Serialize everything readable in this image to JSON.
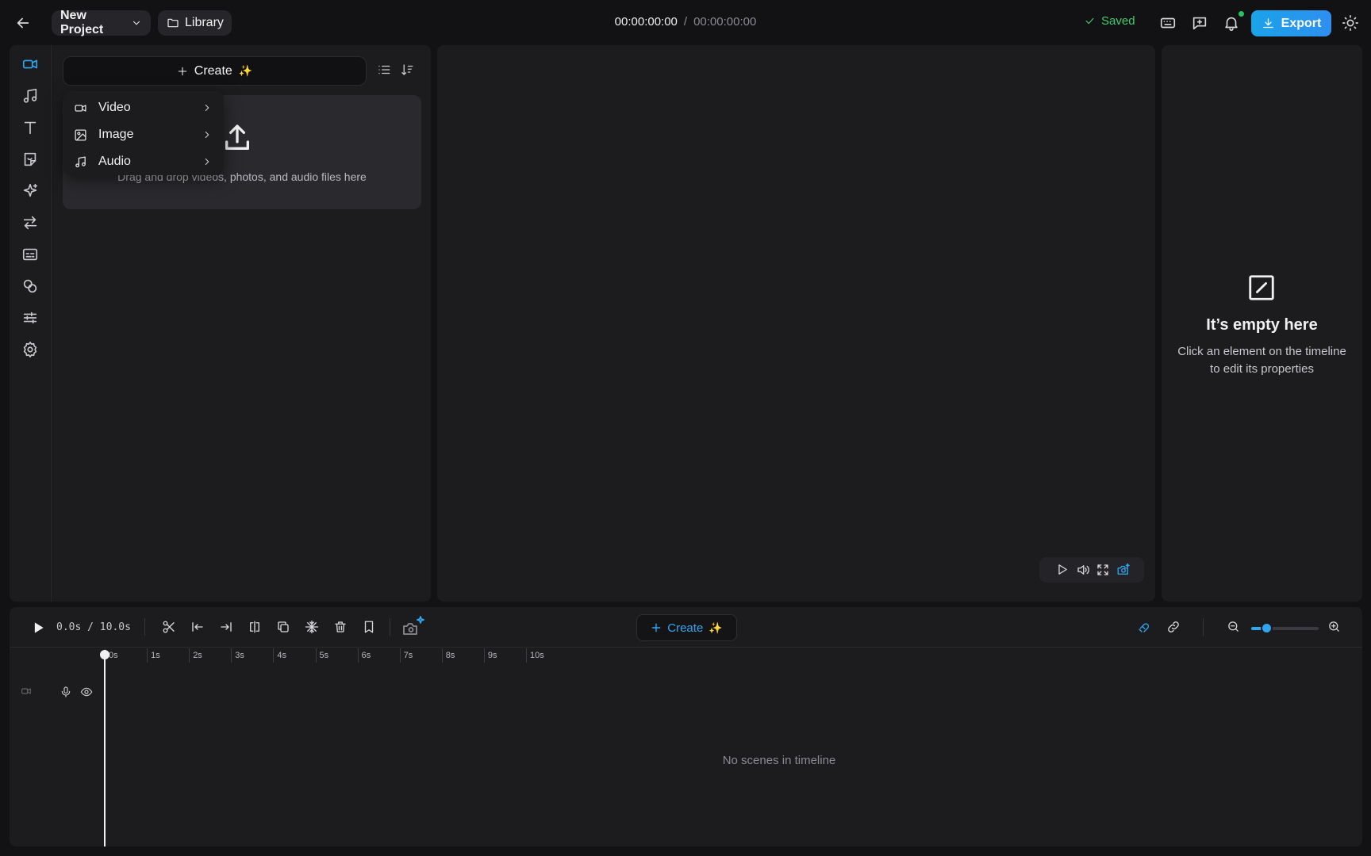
{
  "topbar": {
    "project_name": "New Project",
    "library_label": "Library",
    "timecode_current": "00:00:00:00",
    "timecode_separator": "/",
    "timecode_total": "00:00:00:00",
    "saved_label": "Saved",
    "export_label": "Export"
  },
  "sidebar": {
    "items": [
      {
        "name": "video",
        "icon": "video-camera-icon",
        "active": true
      },
      {
        "name": "audio",
        "icon": "music-note-icon"
      },
      {
        "name": "text",
        "icon": "text-icon"
      },
      {
        "name": "stickers",
        "icon": "sticker-icon"
      },
      {
        "name": "effects",
        "icon": "sparkles-icon"
      },
      {
        "name": "transitions",
        "icon": "transition-arrows-icon"
      },
      {
        "name": "captions",
        "icon": "captions-icon"
      },
      {
        "name": "filters",
        "icon": "filter-circles-icon"
      },
      {
        "name": "adjust",
        "icon": "sliders-icon"
      },
      {
        "name": "settings",
        "icon": "gear-icon"
      }
    ]
  },
  "media_panel": {
    "create_label": "Create",
    "dropzone_text": "Drag and drop videos, photos, and audio files here"
  },
  "create_menu": {
    "items": [
      {
        "label": "Video",
        "icon": "video-camera-icon"
      },
      {
        "label": "Image",
        "icon": "image-icon"
      },
      {
        "label": "Audio",
        "icon": "music-note-icon"
      }
    ]
  },
  "properties": {
    "empty_title": "It’s empty here",
    "empty_subtitle": "Click an element on the timeline to edit its properties"
  },
  "timeline": {
    "time_display": "0.0s / 10.0s",
    "create_label": "Create",
    "ruler_ticks": [
      "0s",
      "1s",
      "2s",
      "3s",
      "4s",
      "5s",
      "6s",
      "7s",
      "8s",
      "9s",
      "10s"
    ],
    "empty_text": "No scenes in timeline",
    "zoom_level": 0.2
  },
  "colors": {
    "accent": "#2ea7f0",
    "saved": "#3fcf6e",
    "background": "#121214",
    "panel": "#1c1c1f"
  }
}
